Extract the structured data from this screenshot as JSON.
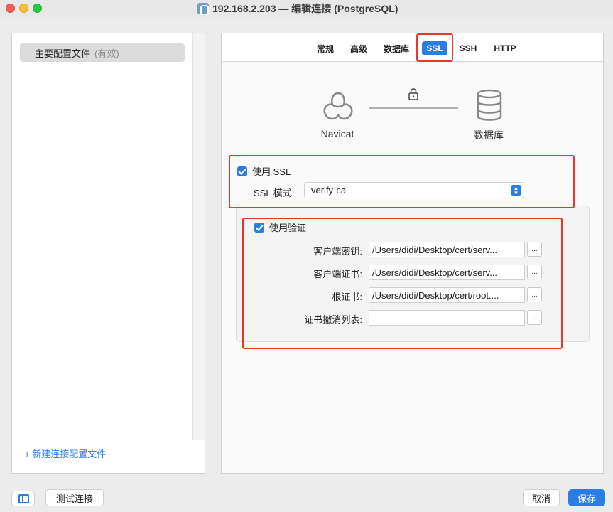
{
  "window": {
    "title": "192.168.2.203 — 编辑连接 (PostgreSQL)"
  },
  "sidebar": {
    "profile_label": "主要配置文件",
    "profile_status": "(有效)",
    "add_profile_label": "新建连接配置文件"
  },
  "tabs": [
    {
      "label": "常规"
    },
    {
      "label": "高级"
    },
    {
      "label": "数据库"
    },
    {
      "label": "SSL"
    },
    {
      "label": "SSH"
    },
    {
      "label": "HTTP"
    }
  ],
  "active_tab": "SSL",
  "diagram": {
    "client_label": "Navicat",
    "server_label": "数据库"
  },
  "ssl": {
    "use_ssl_label": "使用 SSL",
    "use_ssl_checked": true,
    "mode_label": "SSL 模式:",
    "mode_value": "verify-ca"
  },
  "auth": {
    "use_auth_label": "使用验证",
    "use_auth_checked": true,
    "fields": [
      {
        "label": "客户端密钥:",
        "value": "/Users/didi/Desktop/cert/serv..."
      },
      {
        "label": "客户端证书:",
        "value": "/Users/didi/Desktop/cert/serv..."
      },
      {
        "label": "根证书:",
        "value": "/Users/didi/Desktop/cert/root...."
      },
      {
        "label": "证书撤消列表:",
        "value": ""
      }
    ],
    "browse_label": "..."
  },
  "footer": {
    "test_label": "测试连接",
    "cancel_label": "取消",
    "save_label": "保存"
  },
  "colors": {
    "accent": "#2a7de1",
    "highlight_border": "#e8382a"
  },
  "icons": {
    "client": "navicat-logo-icon",
    "server": "database-icon",
    "lock": "lock-icon"
  }
}
